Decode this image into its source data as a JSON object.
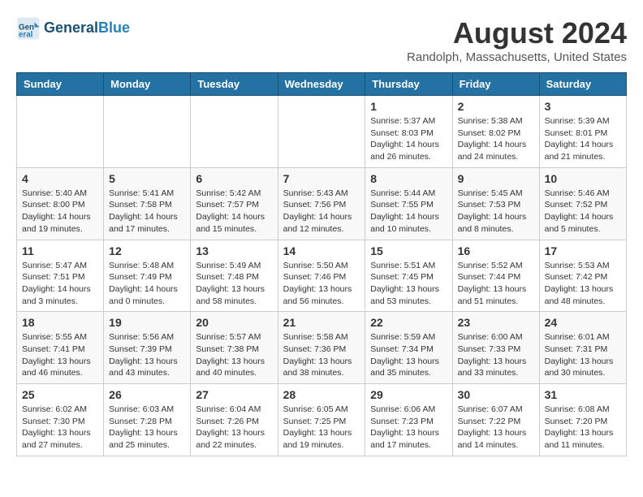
{
  "header": {
    "logo_line1": "General",
    "logo_line2": "Blue",
    "month_year": "August 2024",
    "location": "Randolph, Massachusetts, United States"
  },
  "days_of_week": [
    "Sunday",
    "Monday",
    "Tuesday",
    "Wednesday",
    "Thursday",
    "Friday",
    "Saturday"
  ],
  "weeks": [
    [
      {
        "day": "",
        "info": ""
      },
      {
        "day": "",
        "info": ""
      },
      {
        "day": "",
        "info": ""
      },
      {
        "day": "",
        "info": ""
      },
      {
        "day": "1",
        "info": "Sunrise: 5:37 AM\nSunset: 8:03 PM\nDaylight: 14 hours\nand 26 minutes."
      },
      {
        "day": "2",
        "info": "Sunrise: 5:38 AM\nSunset: 8:02 PM\nDaylight: 14 hours\nand 24 minutes."
      },
      {
        "day": "3",
        "info": "Sunrise: 5:39 AM\nSunset: 8:01 PM\nDaylight: 14 hours\nand 21 minutes."
      }
    ],
    [
      {
        "day": "4",
        "info": "Sunrise: 5:40 AM\nSunset: 8:00 PM\nDaylight: 14 hours\nand 19 minutes."
      },
      {
        "day": "5",
        "info": "Sunrise: 5:41 AM\nSunset: 7:58 PM\nDaylight: 14 hours\nand 17 minutes."
      },
      {
        "day": "6",
        "info": "Sunrise: 5:42 AM\nSunset: 7:57 PM\nDaylight: 14 hours\nand 15 minutes."
      },
      {
        "day": "7",
        "info": "Sunrise: 5:43 AM\nSunset: 7:56 PM\nDaylight: 14 hours\nand 12 minutes."
      },
      {
        "day": "8",
        "info": "Sunrise: 5:44 AM\nSunset: 7:55 PM\nDaylight: 14 hours\nand 10 minutes."
      },
      {
        "day": "9",
        "info": "Sunrise: 5:45 AM\nSunset: 7:53 PM\nDaylight: 14 hours\nand 8 minutes."
      },
      {
        "day": "10",
        "info": "Sunrise: 5:46 AM\nSunset: 7:52 PM\nDaylight: 14 hours\nand 5 minutes."
      }
    ],
    [
      {
        "day": "11",
        "info": "Sunrise: 5:47 AM\nSunset: 7:51 PM\nDaylight: 14 hours\nand 3 minutes."
      },
      {
        "day": "12",
        "info": "Sunrise: 5:48 AM\nSunset: 7:49 PM\nDaylight: 14 hours\nand 0 minutes."
      },
      {
        "day": "13",
        "info": "Sunrise: 5:49 AM\nSunset: 7:48 PM\nDaylight: 13 hours\nand 58 minutes."
      },
      {
        "day": "14",
        "info": "Sunrise: 5:50 AM\nSunset: 7:46 PM\nDaylight: 13 hours\nand 56 minutes."
      },
      {
        "day": "15",
        "info": "Sunrise: 5:51 AM\nSunset: 7:45 PM\nDaylight: 13 hours\nand 53 minutes."
      },
      {
        "day": "16",
        "info": "Sunrise: 5:52 AM\nSunset: 7:44 PM\nDaylight: 13 hours\nand 51 minutes."
      },
      {
        "day": "17",
        "info": "Sunrise: 5:53 AM\nSunset: 7:42 PM\nDaylight: 13 hours\nand 48 minutes."
      }
    ],
    [
      {
        "day": "18",
        "info": "Sunrise: 5:55 AM\nSunset: 7:41 PM\nDaylight: 13 hours\nand 46 minutes."
      },
      {
        "day": "19",
        "info": "Sunrise: 5:56 AM\nSunset: 7:39 PM\nDaylight: 13 hours\nand 43 minutes."
      },
      {
        "day": "20",
        "info": "Sunrise: 5:57 AM\nSunset: 7:38 PM\nDaylight: 13 hours\nand 40 minutes."
      },
      {
        "day": "21",
        "info": "Sunrise: 5:58 AM\nSunset: 7:36 PM\nDaylight: 13 hours\nand 38 minutes."
      },
      {
        "day": "22",
        "info": "Sunrise: 5:59 AM\nSunset: 7:34 PM\nDaylight: 13 hours\nand 35 minutes."
      },
      {
        "day": "23",
        "info": "Sunrise: 6:00 AM\nSunset: 7:33 PM\nDaylight: 13 hours\nand 33 minutes."
      },
      {
        "day": "24",
        "info": "Sunrise: 6:01 AM\nSunset: 7:31 PM\nDaylight: 13 hours\nand 30 minutes."
      }
    ],
    [
      {
        "day": "25",
        "info": "Sunrise: 6:02 AM\nSunset: 7:30 PM\nDaylight: 13 hours\nand 27 minutes."
      },
      {
        "day": "26",
        "info": "Sunrise: 6:03 AM\nSunset: 7:28 PM\nDaylight: 13 hours\nand 25 minutes."
      },
      {
        "day": "27",
        "info": "Sunrise: 6:04 AM\nSunset: 7:26 PM\nDaylight: 13 hours\nand 22 minutes."
      },
      {
        "day": "28",
        "info": "Sunrise: 6:05 AM\nSunset: 7:25 PM\nDaylight: 13 hours\nand 19 minutes."
      },
      {
        "day": "29",
        "info": "Sunrise: 6:06 AM\nSunset: 7:23 PM\nDaylight: 13 hours\nand 17 minutes."
      },
      {
        "day": "30",
        "info": "Sunrise: 6:07 AM\nSunset: 7:22 PM\nDaylight: 13 hours\nand 14 minutes."
      },
      {
        "day": "31",
        "info": "Sunrise: 6:08 AM\nSunset: 7:20 PM\nDaylight: 13 hours\nand 11 minutes."
      }
    ]
  ]
}
